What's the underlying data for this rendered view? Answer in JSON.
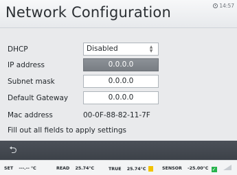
{
  "header": {
    "title": "Network Configuration",
    "time": "14:57"
  },
  "form": {
    "dhcp": {
      "label": "DHCP",
      "value": "Disabled"
    },
    "ip": {
      "label": "IP address",
      "value": "0.0.0.0"
    },
    "subnet": {
      "label": "Subnet mask",
      "value": "0.0.0.0"
    },
    "gateway": {
      "label": "Default Gateway",
      "value": "0.0.0.0"
    },
    "mac": {
      "label": "Mac address",
      "value": "00-0F-88-82-11-7F"
    },
    "hint": "Fill out all fields to apply settings"
  },
  "nav": {
    "back_icon": "back-arrow-icon"
  },
  "status": {
    "set_label": "SET",
    "set_value": "---.-- °C",
    "read_label": "READ",
    "read_value": "25.74°C",
    "true_label": "TRUE",
    "true_value": "25.74°C",
    "sensor_label": "SENSOR",
    "sensor_value": "-25.00°C",
    "colors": {
      "ok": "#27b34c",
      "warn": "#f2c200"
    }
  }
}
